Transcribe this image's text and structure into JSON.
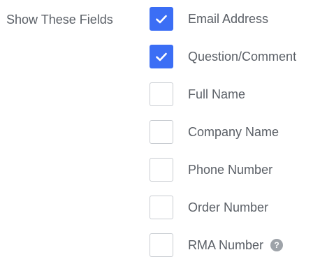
{
  "section_label": "Show These Fields",
  "accent_color": "#3b6ef5",
  "fields": [
    {
      "label": "Email Address",
      "checked": true
    },
    {
      "label": "Question/Comment",
      "checked": true
    },
    {
      "label": "Full Name",
      "checked": false
    },
    {
      "label": "Company Name",
      "checked": false
    },
    {
      "label": "Phone Number",
      "checked": false
    },
    {
      "label": "Order Number",
      "checked": false
    },
    {
      "label": "RMA Number",
      "checked": false,
      "help_icon": "question-mark-icon"
    }
  ]
}
